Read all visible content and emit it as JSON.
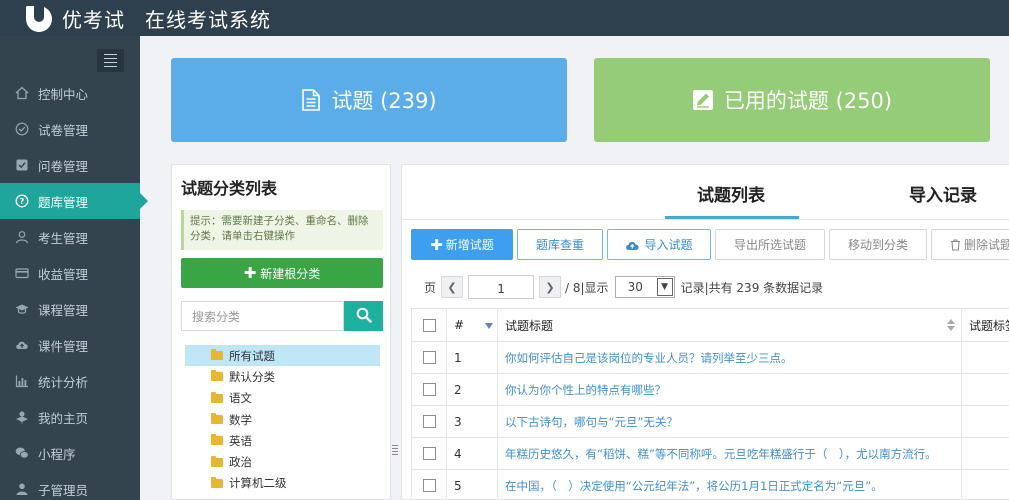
{
  "header": {
    "brand": "优考试",
    "system_title": "在线考试系统",
    "logo_icon": "leaf-logo-icon"
  },
  "sidebar": {
    "items": [
      {
        "label": "控制中心",
        "icon": "home-icon",
        "active": false
      },
      {
        "label": "试卷管理",
        "icon": "check-circle-icon",
        "active": false
      },
      {
        "label": "问卷管理",
        "icon": "check-square-icon",
        "active": false
      },
      {
        "label": "题库管理",
        "icon": "question-circle-icon",
        "active": true
      },
      {
        "label": "考生管理",
        "icon": "user-icon",
        "active": false
      },
      {
        "label": "收益管理",
        "icon": "credit-card-icon",
        "active": false
      },
      {
        "label": "课程管理",
        "icon": "graduation-cap-icon",
        "active": false
      },
      {
        "label": "课件管理",
        "icon": "cloud-upload-icon",
        "active": false
      },
      {
        "label": "统计分析",
        "icon": "bar-chart-icon",
        "active": false
      },
      {
        "label": "我的主页",
        "icon": "profile-icon",
        "active": false
      },
      {
        "label": "小程序",
        "icon": "wechat-icon",
        "active": false
      },
      {
        "label": "子管理员",
        "icon": "admin-icon",
        "active": false
      }
    ]
  },
  "cards": {
    "questions": {
      "label": "试题 (239)",
      "icon": "document-icon",
      "color": "#5badea"
    },
    "used": {
      "label": "已用的试题 (250)",
      "icon": "edit-icon",
      "color": "#94cc78"
    }
  },
  "category": {
    "title": "试题分类列表",
    "tip": "提示：需要新建子分类、重命名、删除分类，请单击右键操作",
    "new_root_label": "新建根分类",
    "search_placeholder": "搜索分类",
    "tree": [
      "所有试题",
      "默认分类",
      "语文",
      "数学",
      "英语",
      "政治",
      "计算机二级"
    ]
  },
  "list": {
    "tabs": [
      "试题列表",
      "导入记录"
    ],
    "toolbar": {
      "add": "新增试题",
      "dedup": "题库查重",
      "import": "导入试题",
      "export": "导出所选试题",
      "move": "移动到分类",
      "delete": "删除试题"
    },
    "pager": {
      "page_label": "页",
      "current_page": "1",
      "total_pages": "/ 8|显示",
      "page_size": "30",
      "summary": "记录|共有 239 条数据记录"
    },
    "columns": {
      "num": "#",
      "title": "试题标题",
      "category": "试题标签"
    },
    "rows": [
      {
        "num": "1",
        "title": "你如何评估自己是该岗位的专业人员？请列举至少三点。"
      },
      {
        "num": "2",
        "title": "你认为你个性上的特点有哪些？"
      },
      {
        "num": "3",
        "title": "以下古诗句，哪句与“元旦”无关？"
      },
      {
        "num": "4",
        "title": "年糕历史悠久，有“稻饼、糕”等不同称呼。元旦吃年糕盛行于（　），尤以南方流行。"
      },
      {
        "num": "5",
        "title": "在中国，（　）决定使用“公元纪年法”，将公历1月1日正式定名为“元旦”。"
      }
    ]
  }
}
